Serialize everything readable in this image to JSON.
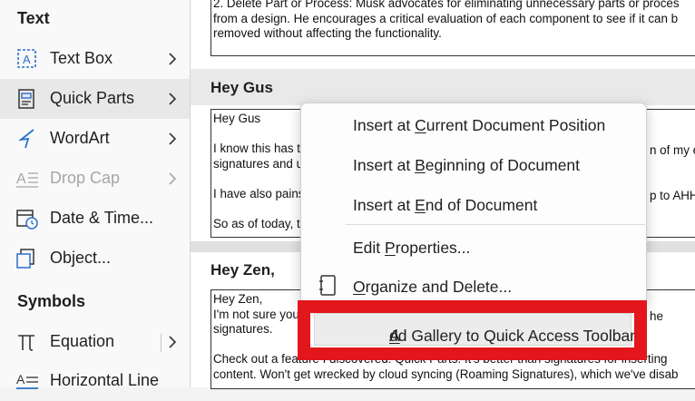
{
  "menu": {
    "section_text": "Text",
    "section_symbols": "Symbols",
    "items": [
      {
        "label": "Text Box",
        "icon": "text-box-icon"
      },
      {
        "label": "Quick Parts",
        "icon": "quick-parts-icon"
      },
      {
        "label": "WordArt",
        "icon": "wordart-icon"
      },
      {
        "label": "Drop Cap",
        "icon": "drop-cap-icon"
      },
      {
        "label": "Date & Time...",
        "icon": "calendar-clock-icon"
      },
      {
        "label": "Object...",
        "icon": "object-icon"
      },
      {
        "label": "Equation",
        "icon": "pi-icon"
      },
      {
        "label": "Horizontal Line",
        "icon": "horizontal-line-icon"
      }
    ]
  },
  "doc": {
    "top_lines": [
      "2. Delete Part or Process: Musk advocates for eliminating unnecessary parts or proces",
      "from a design. He encourages a critical evaluation of each component to see if it can b",
      "removed without affecting the functionality."
    ],
    "entries": [
      {
        "heading": "Hey Gus",
        "lines": [
          "Hey Gus",
          "",
          "I know this has t",
          "signatures and u",
          "",
          "I have also pains",
          "",
          "So as of today, t"
        ],
        "right_fragments": [
          "n of my en",
          "p to AHH."
        ]
      },
      {
        "heading": "Hey Zen,",
        "lines": [
          "Hey Zen,",
          "I'm not sure you",
          "signatures.",
          "",
          "Check out a feature I discovered: Quick Parts. It's better than signatures for inserting",
          "content. Won't get wrecked by cloud syncing (Roaming Signatures), which we've disab"
        ],
        "right_fragments": [
          "he"
        ]
      }
    ]
  },
  "context_menu": {
    "insert_current": {
      "pre": "Insert at ",
      "key": "C",
      "post": "urrent Document Position"
    },
    "insert_beginning": {
      "pre": "Insert at ",
      "key": "B",
      "post": "eginning of Document"
    },
    "insert_end": {
      "pre": "Insert at ",
      "key": "E",
      "post": "nd of Document"
    },
    "edit_properties": {
      "pre": "Edit ",
      "key": "P",
      "post": "roperties..."
    },
    "organize_delete": {
      "pre": "",
      "key": "O",
      "post": "rganize and Delete..."
    },
    "add_gallery": {
      "pre": "",
      "key": "A",
      "post": "dd Gallery to Quick Access Toolbar"
    }
  },
  "colors": {
    "highlight_box": "#e3161b",
    "menu_hover": "#e8e8e8",
    "disabled_text": "#a6a6a6"
  }
}
